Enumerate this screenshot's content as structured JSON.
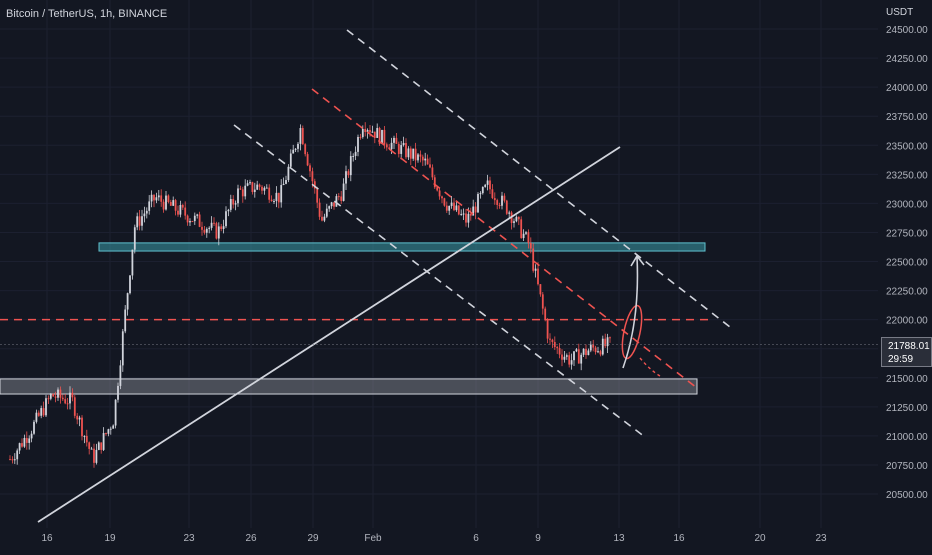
{
  "header": {
    "title": "Bitcoin / TetherUS, 1h, BINANCE",
    "currency": "USDT"
  },
  "price_label": {
    "price": "21788.01",
    "countdown": "29:59"
  },
  "colors": {
    "background": "#131722",
    "up_candle": "#d1d4dc",
    "down_candle": "#ef5350",
    "dashed_white": "#d1d4dc",
    "dashed_red": "#ef5350",
    "resistance_zone": "#3a9aa8",
    "support_zone": "#b2b5be"
  },
  "chart_data": {
    "type": "candlestick",
    "title": "Bitcoin / TetherUS, 1h, BINANCE",
    "ylabel": "USDT",
    "ylim": [
      20375,
      24580
    ],
    "yticks": [
      20500,
      20750,
      21000,
      21250,
      21500,
      21750,
      22000,
      22250,
      22500,
      22750,
      23000,
      23250,
      23500,
      23750,
      24000,
      24250,
      24500
    ],
    "ytick_labels": [
      "20500.00",
      "20750.00",
      "21000.00",
      "21250.00",
      "21500.00",
      "21750.00",
      "22000.00",
      "22250.00",
      "22500.00",
      "22750.00",
      "23000.00",
      "23250.00",
      "23500.00",
      "23750.00",
      "24000.00",
      "24250.00",
      "24500.00"
    ],
    "xticks": [
      "16",
      "19",
      "23",
      "26",
      "29",
      "Feb",
      "6",
      "9",
      "13",
      "16",
      "20",
      "23"
    ],
    "price_path": [
      {
        "t": "Jan 15",
        "p": 20800
      },
      {
        "t": "Jan 16",
        "p": 21050
      },
      {
        "t": "Jan 17",
        "p": 21350
      },
      {
        "t": "Jan 18",
        "p": 21300
      },
      {
        "t": "Jan 19",
        "p": 20800
      },
      {
        "t": "Jan 20",
        "p": 21150
      },
      {
        "t": "Jan 21",
        "p": 22800
      },
      {
        "t": "Jan 22",
        "p": 23050
      },
      {
        "t": "Jan 23",
        "p": 22950
      },
      {
        "t": "Jan 24",
        "p": 22850
      },
      {
        "t": "Jan 25",
        "p": 22750
      },
      {
        "t": "Jan 26",
        "p": 23100
      },
      {
        "t": "Jan 27",
        "p": 23150
      },
      {
        "t": "Jan 28",
        "p": 23050
      },
      {
        "t": "Jan 29",
        "p": 23650
      },
      {
        "t": "Jan 30",
        "p": 22850
      },
      {
        "t": "Jan 31",
        "p": 23100
      },
      {
        "t": "Feb 1",
        "p": 23700
      },
      {
        "t": "Feb 2",
        "p": 23550
      },
      {
        "t": "Feb 3",
        "p": 23450
      },
      {
        "t": "Feb 4",
        "p": 23350
      },
      {
        "t": "Feb 5",
        "p": 23000
      },
      {
        "t": "Feb 6",
        "p": 22850
      },
      {
        "t": "Feb 7",
        "p": 23150
      },
      {
        "t": "Feb 8",
        "p": 22950
      },
      {
        "t": "Feb 9",
        "p": 22650
      },
      {
        "t": "Feb 10",
        "p": 21800
      },
      {
        "t": "Feb 11",
        "p": 21650
      },
      {
        "t": "Feb 12",
        "p": 21750
      },
      {
        "t": "Feb 13",
        "p": 21788
      }
    ],
    "zones": [
      {
        "name": "resistance",
        "low": 22590,
        "high": 22660
      },
      {
        "name": "support",
        "low": 21360,
        "high": 21490
      }
    ],
    "horizontal_level": 22000,
    "last_price": 21788.01
  }
}
